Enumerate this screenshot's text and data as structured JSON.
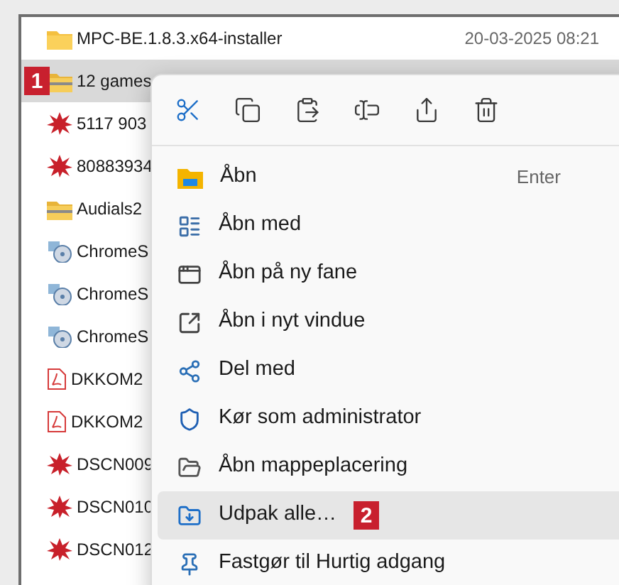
{
  "files": [
    {
      "name": "MPC-BE.1.8.3.x64-installer",
      "date": "20-03-2025 08:21",
      "kind": "folder",
      "selected": false
    },
    {
      "name": "12 games",
      "kind": "zip",
      "selected": true,
      "callout": "1"
    },
    {
      "name": "5117 903",
      "kind": "image",
      "selected": false
    },
    {
      "name": "80883934",
      "kind": "image",
      "selected": false
    },
    {
      "name": "Audials2",
      "kind": "zip",
      "selected": false
    },
    {
      "name": "ChromeS",
      "kind": "installer",
      "selected": false
    },
    {
      "name": "ChromeS",
      "kind": "installer",
      "selected": false
    },
    {
      "name": "ChromeS",
      "kind": "installer",
      "selected": false
    },
    {
      "name": "DKKOM2",
      "kind": "pdf",
      "selected": false
    },
    {
      "name": "DKKOM2",
      "kind": "pdf",
      "selected": false
    },
    {
      "name": "DSCN009",
      "kind": "image",
      "selected": false
    },
    {
      "name": "DSCN010",
      "kind": "image",
      "selected": false
    },
    {
      "name": "DSCN012",
      "kind": "image",
      "selected": false
    }
  ],
  "context_menu": {
    "items": [
      {
        "label": "Åbn",
        "shortcut": "Enter",
        "selected": false
      },
      {
        "label": "Åbn med",
        "selected": false
      },
      {
        "label": "Åbn på ny fane",
        "selected": false
      },
      {
        "label": "Åbn i nyt vindue",
        "selected": false
      },
      {
        "label": "Del med",
        "selected": false
      },
      {
        "label": "Kør som administrator",
        "selected": false
      },
      {
        "label": "Åbn mappeplacering",
        "selected": false
      },
      {
        "label": "Udpak alle…",
        "selected": true,
        "callout": "2"
      },
      {
        "label": "Fastgør til Hurtig adgang",
        "selected": false
      }
    ]
  }
}
